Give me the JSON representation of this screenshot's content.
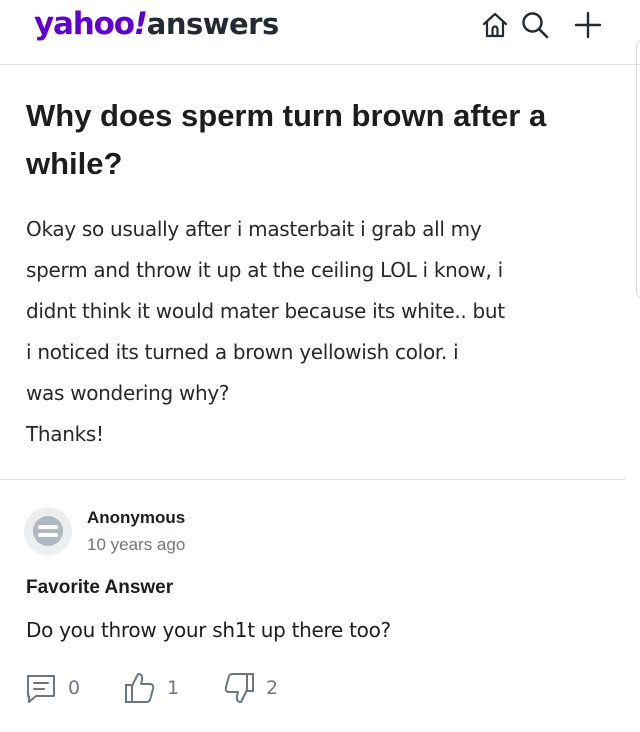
{
  "app": {
    "logo_main": "yahoo",
    "logo_bang": "!",
    "logo_sub": "answers"
  },
  "header": {
    "icons": [
      "home-icon",
      "search-icon",
      "plus-icon"
    ]
  },
  "question": {
    "title": "Why does sperm turn brown after a while?",
    "body_lines": [
      "Okay so usually after i masterbait i grab all my",
      "sperm and throw it up at the ceiling LOL i know, i",
      "didnt think it would mater because its white.. but",
      "i noticed its turned a brown yellowish color. i",
      "was wondering why?",
      "Thanks!"
    ]
  },
  "answer": {
    "author": "Anonymous",
    "time": "10 years ago",
    "label": "Favorite Answer",
    "text": "Do you throw your sh1t up there too?",
    "comments": "0",
    "likes": "1",
    "dislikes": "2"
  },
  "colors": {
    "brand": "#6001d2",
    "text": "#1d1d1d",
    "muted": "#6e7780",
    "divider": "#e2e2e2"
  }
}
